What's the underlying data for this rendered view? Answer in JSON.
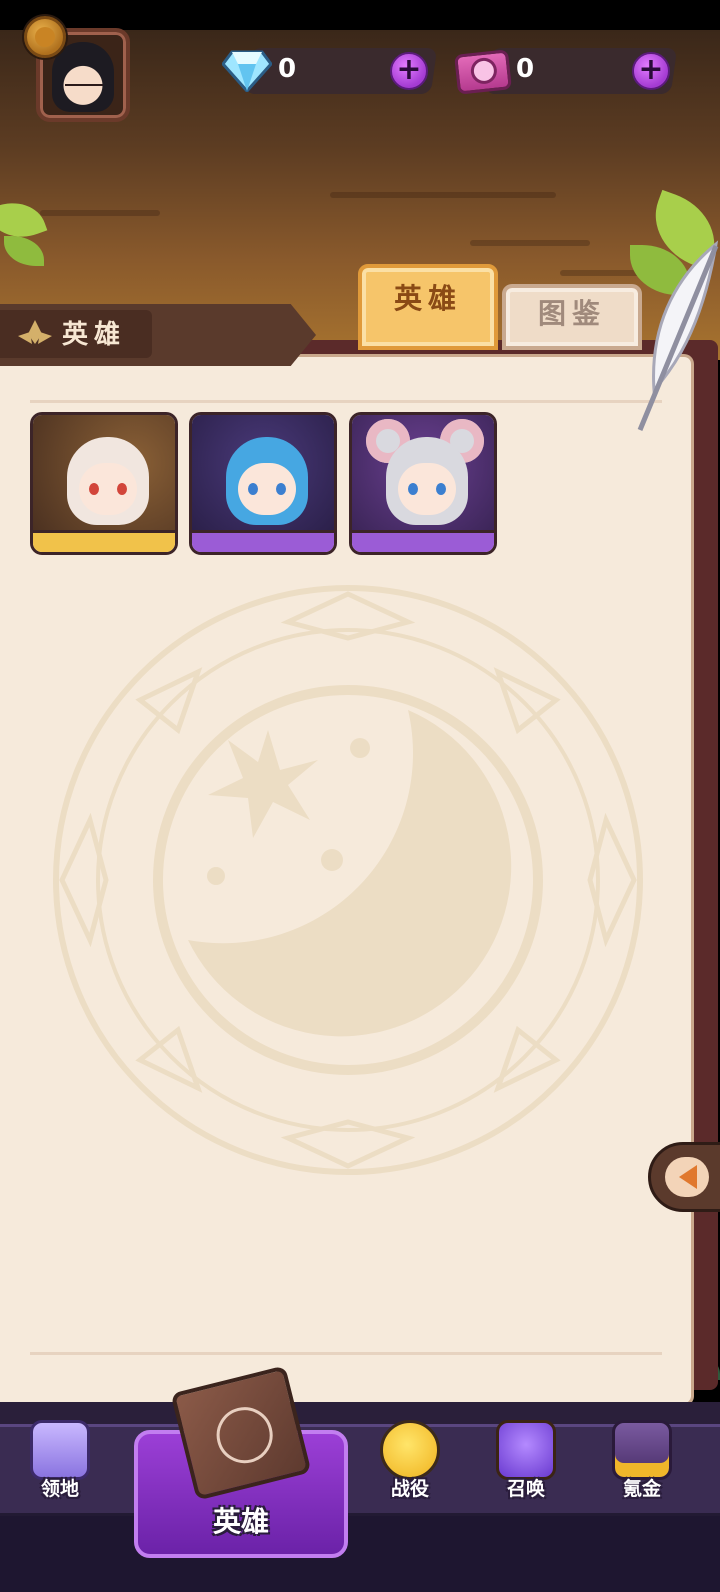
{
  "currencies": [
    {
      "name": "diamond",
      "value": "0",
      "icon": "diamond-icon"
    },
    {
      "name": "summon-ticket",
      "value": "0",
      "icon": "ticket-icon"
    }
  ],
  "tabs": [
    {
      "label": "英雄",
      "active": true
    },
    {
      "label": "图鉴",
      "active": false
    }
  ],
  "section": {
    "title": "英雄"
  },
  "heroes": [
    {
      "name": "hero-card-1",
      "rarity_color": "#f1c24a",
      "hair": "#f1e6df",
      "eyes": "#d2453a",
      "bg": "#6b4a2f"
    },
    {
      "name": "hero-card-2",
      "rarity_color": "#9b5cd6",
      "hair": "#46a7e2",
      "eyes": "#3b7fd0",
      "bg": "#3a2a5a"
    },
    {
      "name": "hero-card-3",
      "rarity_color": "#9b5cd6",
      "hair": "#d9d9df",
      "eyes": "#3b7fd0",
      "bg": "#4a2a66"
    }
  ],
  "nav": {
    "items": [
      {
        "label": "领地",
        "icon": "castle-icon"
      },
      {
        "label": "英雄",
        "icon": "book-icon",
        "active": true
      },
      {
        "label": "战役",
        "icon": "chick-warrior-icon"
      },
      {
        "label": "召唤",
        "icon": "summon-altar-icon"
      },
      {
        "label": "氪金",
        "icon": "treasure-chest-icon"
      }
    ]
  },
  "colors": {
    "accent": "#9b3fd6",
    "page": "#f6eadb",
    "gold": "#f6c56a"
  }
}
